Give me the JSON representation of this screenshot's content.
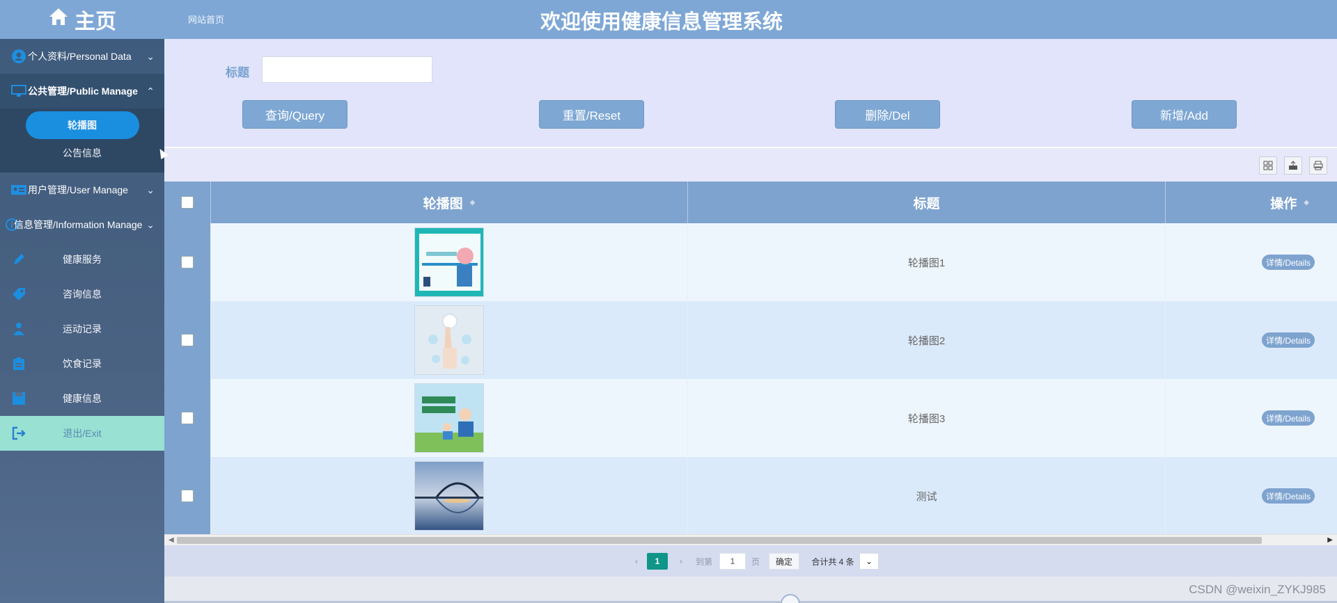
{
  "brand": {
    "icon": "home-icon",
    "title": "主页"
  },
  "header": {
    "site_home": "网站首页",
    "system_title": "欢迎使用健康信息管理系统"
  },
  "sidebar": {
    "groups": [
      {
        "icon": "user-circle-icon",
        "label": "个人资料/Personal Data",
        "expanded": false
      },
      {
        "icon": "monitor-icon",
        "label": "公共管理/Public Manage",
        "expanded": true,
        "children": [
          {
            "label": "轮播图",
            "active": true
          },
          {
            "label": "公告信息",
            "active": false
          }
        ]
      },
      {
        "icon": "id-card-icon",
        "label": "用户管理/User Manage",
        "expanded": false
      },
      {
        "icon": "info-circle-icon",
        "label": "信息管理/Information Manage",
        "expanded": false
      }
    ],
    "items": [
      {
        "icon": "pen-icon",
        "label": "健康服务"
      },
      {
        "icon": "tag-icon",
        "label": "咨询信息"
      },
      {
        "icon": "person-icon",
        "label": "运动记录"
      },
      {
        "icon": "clipboard-icon",
        "label": "饮食记录"
      },
      {
        "icon": "save-icon",
        "label": "健康信息"
      }
    ],
    "exit": {
      "icon": "logout-icon",
      "label": "退出/Exit"
    }
  },
  "search": {
    "title_label": "标题",
    "title_value": ""
  },
  "buttons": {
    "query": "查询/Query",
    "reset": "重置/Reset",
    "delete": "删除/Del",
    "add": "新增/Add"
  },
  "toolbar": {
    "icons": [
      "columns-icon",
      "export-icon",
      "print-icon"
    ]
  },
  "table": {
    "columns": [
      "轮播图",
      "标题",
      "操作"
    ],
    "rows": [
      {
        "image": "carousel-image-1",
        "title": "轮播图1",
        "action": "详情/Details"
      },
      {
        "image": "carousel-image-2",
        "title": "轮播图2",
        "action": "详情/Details"
      },
      {
        "image": "carousel-image-3",
        "title": "轮播图3",
        "action": "详情/Details"
      },
      {
        "image": "carousel-image-4",
        "title": "测试",
        "action": "详情/Details"
      }
    ]
  },
  "pagination": {
    "current_page": "1",
    "goto_label": "到第",
    "goto_value": "1",
    "page_suffix": "页",
    "confirm": "确定",
    "total": "合计共 4 条"
  },
  "watermark": "CSDN @weixin_ZYKJ985",
  "colors": {
    "header_bg": "#7ea7d6",
    "sidebar_active": "#1a8fe0",
    "pager_current": "#0f9688",
    "exit_bg": "#98e1d3"
  }
}
